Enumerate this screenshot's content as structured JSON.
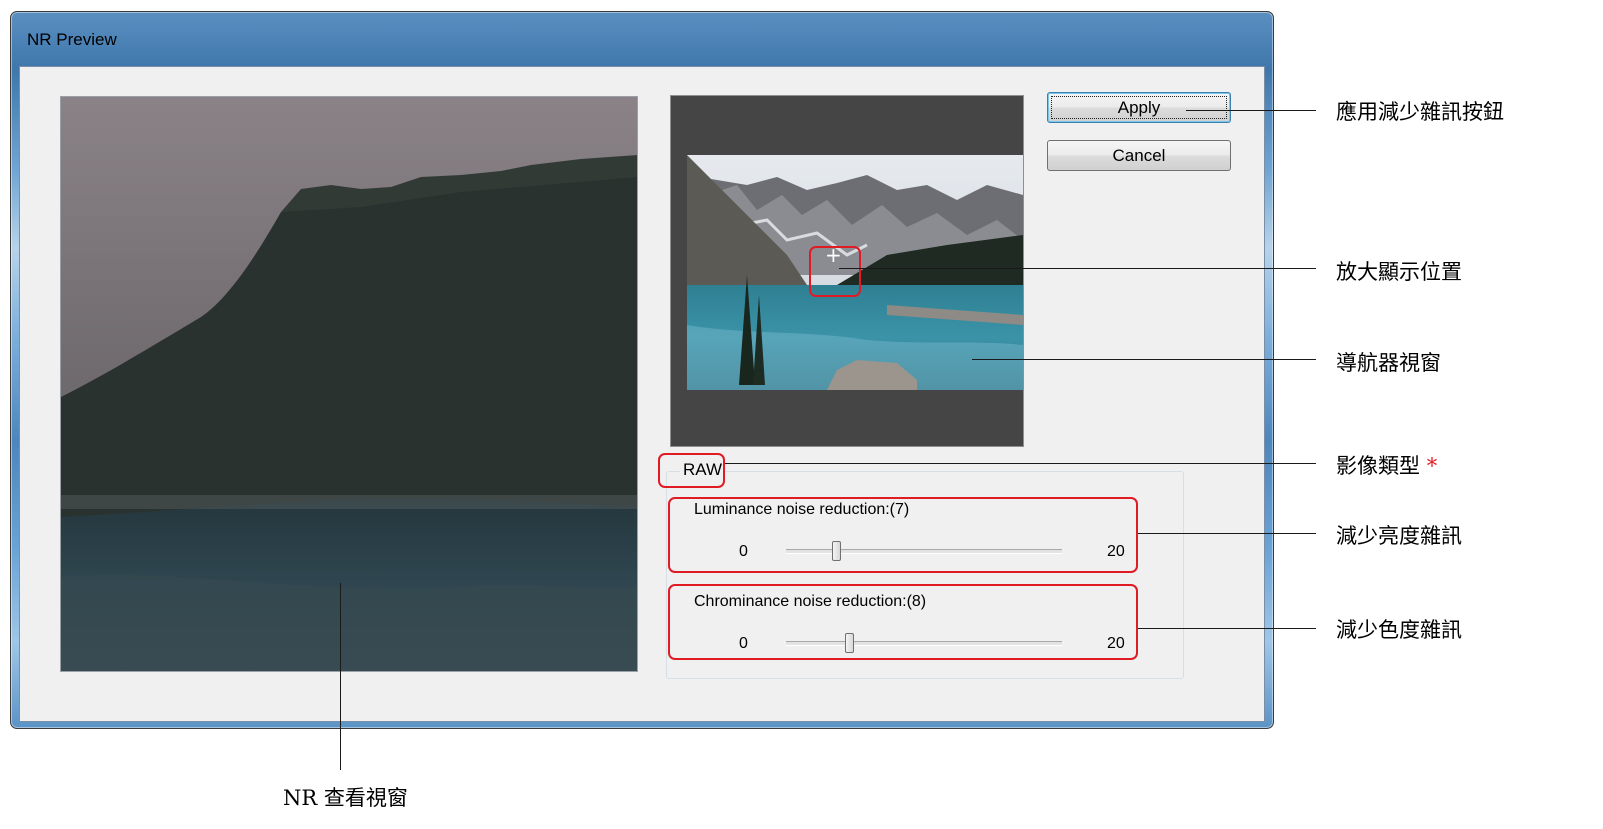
{
  "window": {
    "title": "NR Preview"
  },
  "buttons": {
    "apply": "Apply",
    "cancel": "Cancel"
  },
  "settings": {
    "image_type": "RAW",
    "luminance": {
      "label": "Luminance noise reduction:(7)",
      "min": "0",
      "max": "20",
      "value": 7
    },
    "chrominance": {
      "label": "Chrominance noise reduction:(8)",
      "min": "0",
      "max": "20",
      "value": 8
    }
  },
  "navigator": {
    "position_marker": "+"
  },
  "callouts": {
    "apply": "應用減少雜訊按鈕",
    "zoom_position": "放大顯示位置",
    "navigator": "導航器視窗",
    "image_type": "影像類型",
    "image_type_note": "*",
    "luminance": "減少亮度雜訊",
    "chrominance": "減少色度雜訊",
    "nr_viewer": "NR 查看視窗"
  },
  "colors": {
    "highlight": "#e01b24",
    "title_bar": "#4a80b8"
  }
}
